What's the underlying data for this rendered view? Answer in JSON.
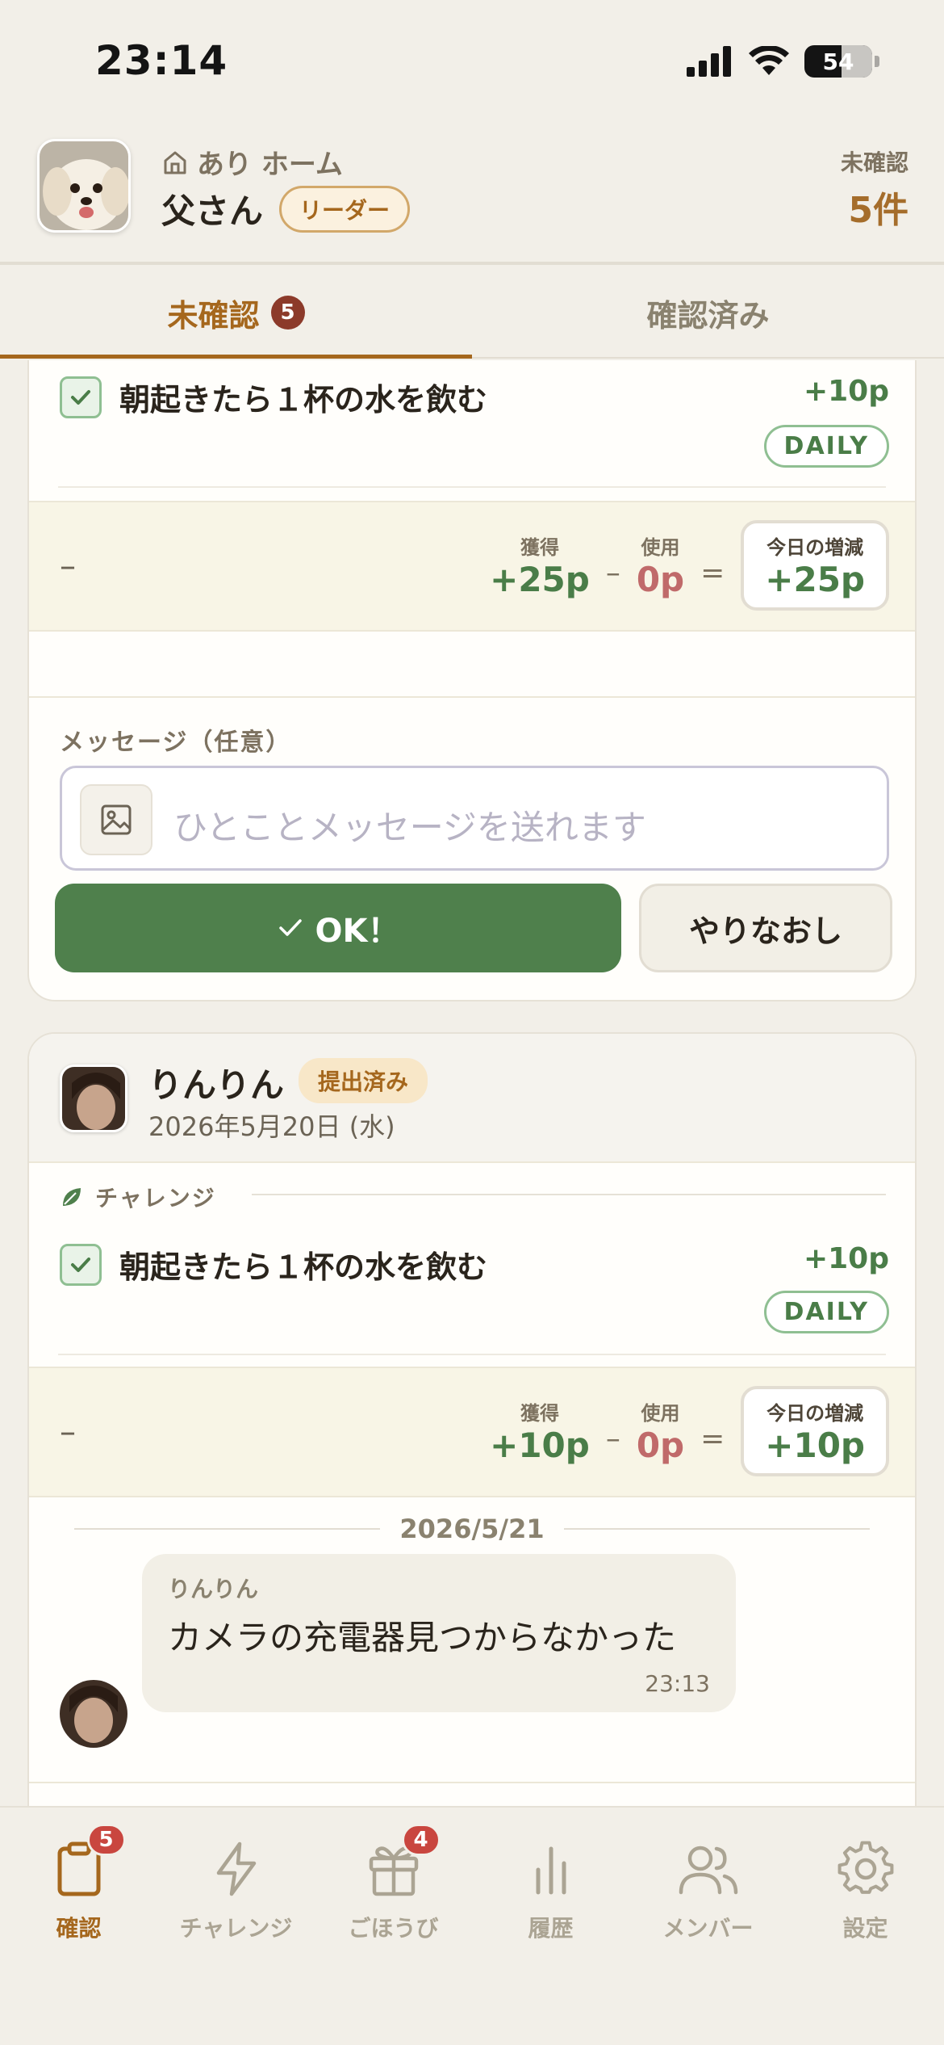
{
  "status_bar": {
    "time": "23:14",
    "battery": "54"
  },
  "header": {
    "home_name": "あり ホーム",
    "user_name": "父さん",
    "role_badge": "リーダー",
    "pending_label": "未確認",
    "pending_count": "5件"
  },
  "tabs": [
    {
      "label": "未確認",
      "badge": "5",
      "active": true
    },
    {
      "label": "確認済み",
      "active": false
    }
  ],
  "card1": {
    "task_title": "朝起きたら１杯の水を飲む",
    "task_points": "+10p",
    "frequency_badge": "DAILY",
    "summary": {
      "dash": "–",
      "gain_label": "獲得",
      "gain_value": "+25p",
      "minus": "–",
      "use_label": "使用",
      "use_value": "0p",
      "equals": "=",
      "total_label": "今日の増減",
      "total_value": "+25p"
    },
    "message_label": "メッセージ（任意）",
    "message_placeholder": "ひとことメッセージを送れます",
    "ok_button": "OK！",
    "redo_button": "やりなおし"
  },
  "card2": {
    "member_name": "りんりん",
    "status_badge": "提出済み",
    "date": "2026年5月20日 (水)",
    "section_label": "チャレンジ",
    "task_title": "朝起きたら１杯の水を飲む",
    "task_points": "+10p",
    "frequency_badge": "DAILY",
    "summary": {
      "dash": "–",
      "gain_label": "獲得",
      "gain_value": "+10p",
      "minus": "–",
      "use_label": "使用",
      "use_value": "0p",
      "equals": "=",
      "total_label": "今日の増減",
      "total_value": "+10p"
    },
    "chat_date": "2026/5/21",
    "chat": {
      "sender": "りんりん",
      "text": "カメラの充電器見つからなかった",
      "time": "23:13"
    }
  },
  "bottom_nav": [
    {
      "label": "確認",
      "icon": "clipboard-icon",
      "badge": "5",
      "active": true
    },
    {
      "label": "チャレンジ",
      "icon": "lightning-icon",
      "active": false
    },
    {
      "label": "ごほうび",
      "icon": "gift-icon",
      "badge": "4",
      "active": false
    },
    {
      "label": "履歴",
      "icon": "bar-chart-icon",
      "active": false
    },
    {
      "label": "メンバー",
      "icon": "users-icon",
      "active": false
    },
    {
      "label": "設定",
      "icon": "gear-icon",
      "active": false
    }
  ],
  "colors": {
    "accent": "#a5671d",
    "primary_green": "#4f804c",
    "use_red": "#c06a6a",
    "badge_red": "#c9463f"
  }
}
